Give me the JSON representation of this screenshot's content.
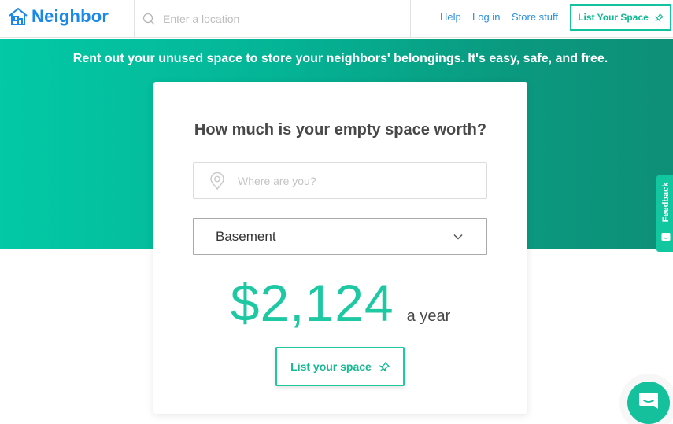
{
  "header": {
    "brand": "Neighbor",
    "search_placeholder": "Enter a location",
    "nav": {
      "help": "Help",
      "login": "Log in",
      "store": "Store stuff"
    },
    "list_space_label": "List Your Space"
  },
  "hero": {
    "tagline": "Rent out your unused space to store your neighbors' belongings. It's easy, safe, and free."
  },
  "card": {
    "title": "How much is your empty space worth?",
    "location_placeholder": "Where are you?",
    "location_value": "",
    "space_type_selected": "Basement",
    "price": "$2,124",
    "price_unit": "a year",
    "cta_label": "List your space"
  },
  "widgets": {
    "feedback_label": "Feedback"
  },
  "colors": {
    "brand_blue": "#1a88e8",
    "accent_teal": "#1ec8a2",
    "hero_gradient_start": "#03c9a6",
    "hero_gradient_end": "#0e8f77"
  },
  "icons": {
    "logo": "house-icon",
    "search": "search-icon",
    "pin_top": "pushpin-icon",
    "location": "map-pin-icon",
    "select": "chevron-down-icon",
    "pin_cta": "pushpin-icon",
    "feedback": "smiley-icon",
    "chat": "chat-bubble-icon"
  }
}
